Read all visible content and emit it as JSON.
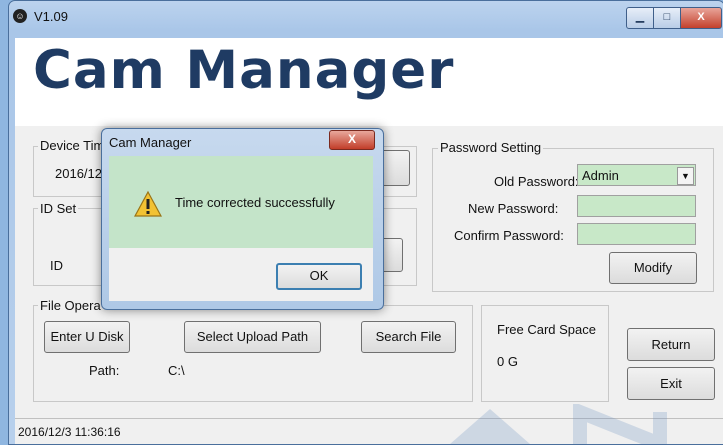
{
  "window": {
    "title": "V1.09",
    "app_icon_glyph": "☺",
    "min_glyph": "▁",
    "max_glyph": "□",
    "close_glyph": "X"
  },
  "banner": {
    "title": "Cam Manager"
  },
  "device_time": {
    "legend": "Device Tim",
    "value": "2016/12"
  },
  "id_set": {
    "legend": "ID Set",
    "id_label": "ID"
  },
  "password": {
    "legend": "Password Setting",
    "old_label": "Old Password:",
    "old_value": "Admin",
    "new_label": "New Password:",
    "confirm_label": "Confirm Password:",
    "modify_label": "Modify"
  },
  "file_ops": {
    "legend": "File Opera",
    "enter_udisk_label": "Enter U Disk",
    "select_path_label": "Select Upload Path",
    "search_file_label": "Search File",
    "path_label": "Path:",
    "path_value": "C:\\"
  },
  "free_space": {
    "label": "Free Card Space",
    "value": "0 G"
  },
  "actions": {
    "return_label": "Return",
    "exit_label": "Exit"
  },
  "status": {
    "datetime": "2016/12/3 11:36:16"
  },
  "dialog": {
    "title": "Cam Manager",
    "message": "Time corrected successfully",
    "ok_label": "OK",
    "close_glyph": "X",
    "icon": "warning-icon"
  },
  "colors": {
    "title_blue": "#1f3b63",
    "input_green": "#c8e8c8",
    "dialog_green": "#c4e4c9"
  }
}
